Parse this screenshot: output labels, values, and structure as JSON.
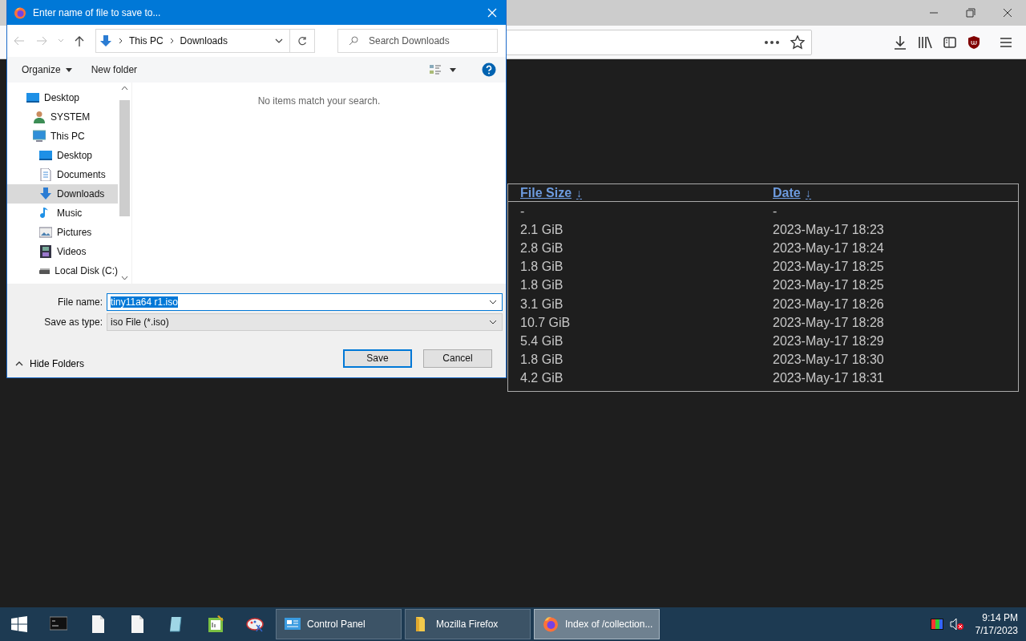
{
  "browser": {
    "listing": {
      "columns": [
        {
          "label": "File Size",
          "sort_mark": "↓"
        },
        {
          "label": "Date",
          "sort_mark": "↓"
        }
      ],
      "rows": [
        {
          "file_size": "-",
          "date": "-"
        },
        {
          "file_size": "2.1 GiB",
          "date": "2023-May-17 18:23"
        },
        {
          "file_size": "2.8 GiB",
          "date": "2023-May-17 18:24"
        },
        {
          "file_size": "1.8 GiB",
          "date": "2023-May-17 18:25"
        },
        {
          "file_size": "1.8 GiB",
          "date": "2023-May-17 18:25"
        },
        {
          "file_size": "3.1 GiB",
          "date": "2023-May-17 18:26"
        },
        {
          "file_size": "10.7 GiB",
          "date": "2023-May-17 18:28"
        },
        {
          "file_size": "5.4 GiB",
          "date": "2023-May-17 18:29"
        },
        {
          "file_size": "1.8 GiB",
          "date": "2023-May-17 18:30"
        },
        {
          "file_size": "4.2 GiB",
          "date": "2023-May-17 18:31"
        }
      ]
    }
  },
  "dialog": {
    "title": "Enter name of file to save to...",
    "breadcrumb": [
      "This PC",
      "Downloads"
    ],
    "search": {
      "placeholder": "Search Downloads"
    },
    "commands": [
      "Organize",
      "New folder"
    ],
    "nav_tree": [
      {
        "label": "Desktop",
        "kind": "desktop",
        "selected": false,
        "children": [
          {
            "label": "SYSTEM",
            "kind": "user",
            "selected": false
          },
          {
            "label": "This PC",
            "kind": "pc",
            "selected": false,
            "children": [
              {
                "label": "Desktop",
                "kind": "desktop",
                "selected": false
              },
              {
                "label": "Documents",
                "kind": "documents",
                "selected": false
              },
              {
                "label": "Downloads",
                "kind": "downloads",
                "selected": true
              },
              {
                "label": "Music",
                "kind": "music",
                "selected": false
              },
              {
                "label": "Pictures",
                "kind": "pictures",
                "selected": false
              },
              {
                "label": "Videos",
                "kind": "videos",
                "selected": false
              },
              {
                "label": "Local Disk (C:)",
                "kind": "disk",
                "selected": false
              }
            ]
          }
        ]
      }
    ],
    "empty_message": "No items match your search.",
    "file_name": {
      "label": "File name:",
      "value": "tiny11a64 r1.iso"
    },
    "save_as_type": {
      "label": "Save as type:",
      "value": "iso File (*.iso)"
    },
    "hide_folders": "Hide Folders",
    "buttons": [
      {
        "label": "Save",
        "default": true
      },
      {
        "label": "Cancel",
        "default": false
      }
    ]
  },
  "taskbar": {
    "pinned": [
      {
        "kind": "terminal"
      },
      {
        "kind": "document"
      },
      {
        "kind": "document"
      },
      {
        "kind": "notepad"
      },
      {
        "kind": "chart"
      },
      {
        "kind": "paint"
      }
    ],
    "tasks": [
      {
        "label": "Control Panel",
        "kind": "control",
        "selected": false
      },
      {
        "label": "Mozilla Firefox",
        "kind": "folder",
        "selected": false
      },
      {
        "label": "Index of /collection...",
        "kind": "firefox",
        "selected": true
      }
    ],
    "clock": {
      "time": "9:14 PM",
      "date": "7/17/2023"
    }
  }
}
